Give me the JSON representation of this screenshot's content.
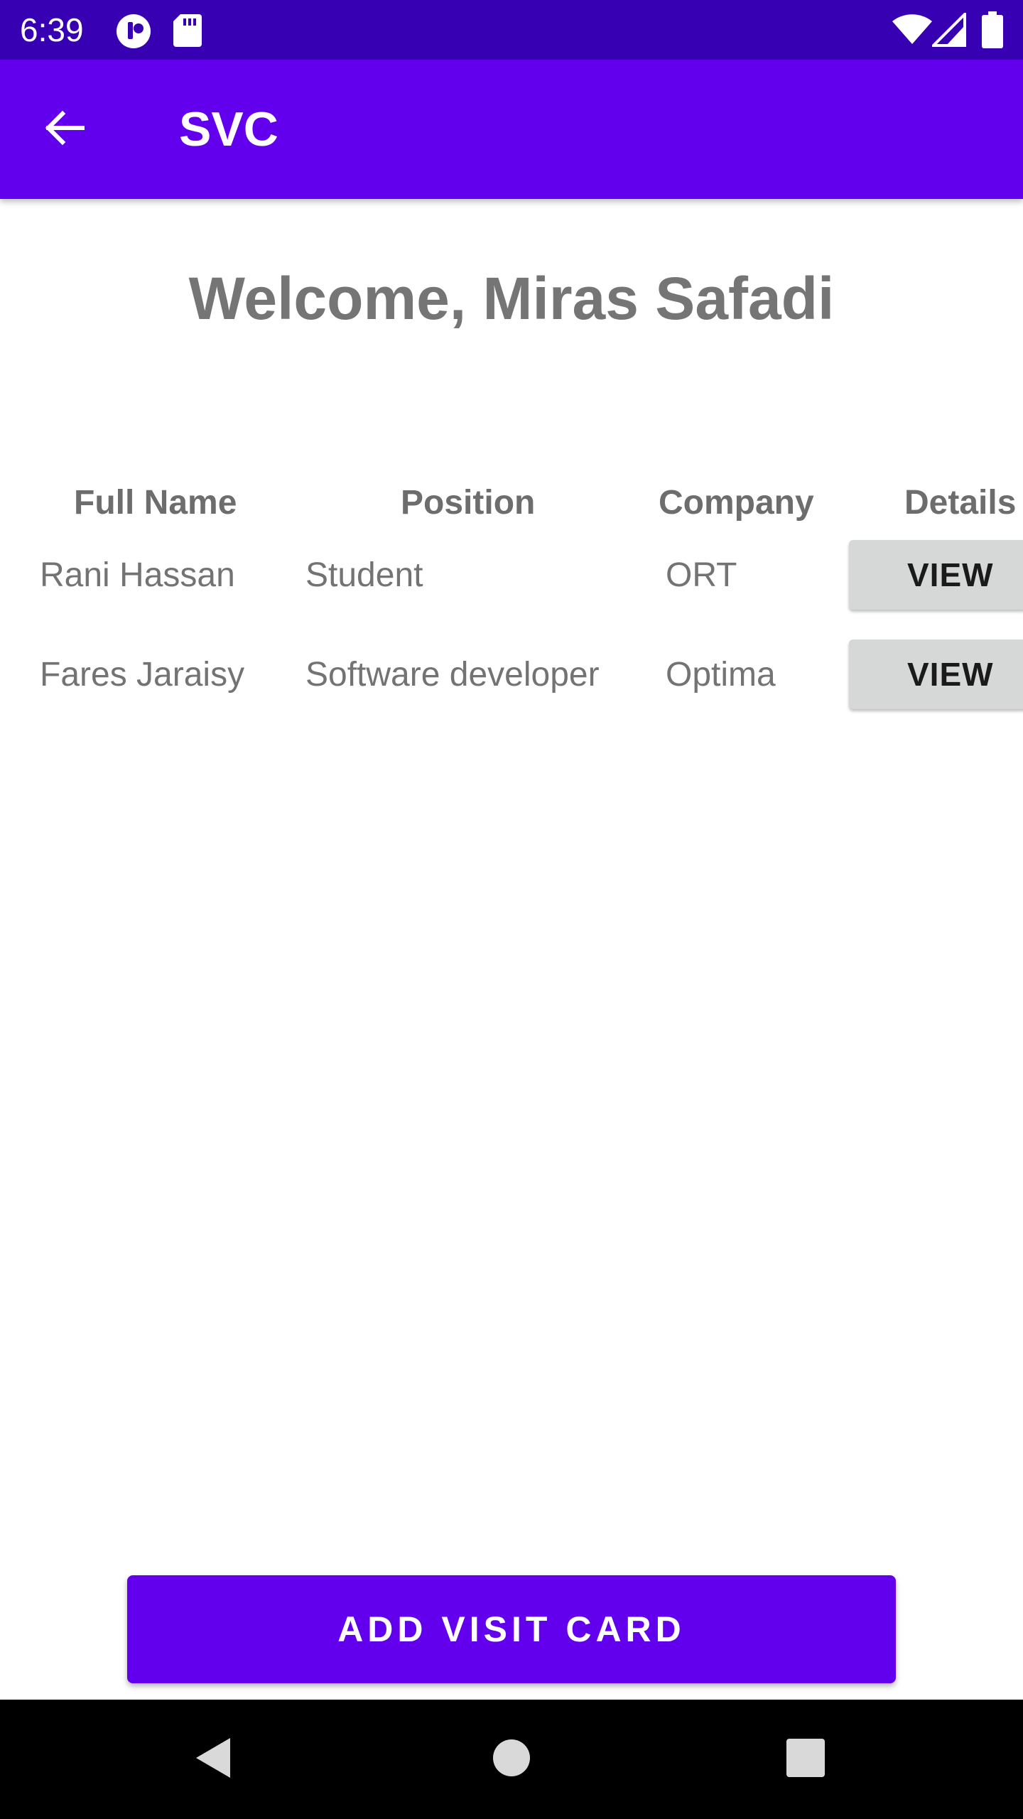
{
  "status_bar": {
    "time": "6:39",
    "icons": [
      "notification-app-icon",
      "sd-card-icon",
      "wifi-icon",
      "signal-icon",
      "battery-icon"
    ]
  },
  "app_bar": {
    "title": "SVC",
    "back_icon": "arrow-back-icon"
  },
  "welcome_text": "Welcome, Miras Safadi",
  "table": {
    "headers": [
      "Full Name",
      "Position",
      "Company",
      "Details"
    ],
    "rows": [
      {
        "full_name": "Rani Hassan",
        "position": "Student",
        "company": "ORT",
        "action_label": "VIEW"
      },
      {
        "full_name": "Fares Jaraisy",
        "position": "Software developer",
        "company": "Optima",
        "action_label": "VIEW"
      }
    ]
  },
  "add_button_label": "ADD VISIT CARD",
  "nav_bar": {
    "icons": [
      "nav-back-icon",
      "nav-home-icon",
      "nav-recents-icon"
    ]
  },
  "colors": {
    "status_bar": "#3700b3",
    "app_bar": "#6200ee",
    "primary_button": "#6200ee",
    "secondary_button": "#d6d7d7",
    "text_muted": "#757575"
  }
}
